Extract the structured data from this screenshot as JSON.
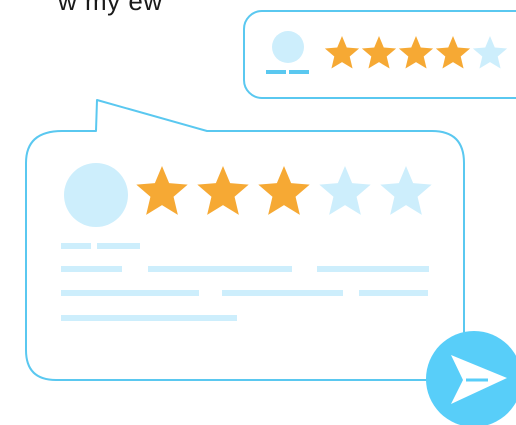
{
  "top_text": "w my ew",
  "colors": {
    "accent_blue": "#5ac8f0",
    "light_blue": "#cdeefc",
    "star_gold": "#f6a934",
    "star_empty": "#cdeefc",
    "send_button": "#58cef9",
    "white": "#ffffff"
  },
  "small_review_card": {
    "rating": 4,
    "max_rating": 5,
    "icon": "avatar-icon"
  },
  "main_review_card": {
    "rating": 3,
    "max_rating": 5,
    "icon": "avatar-icon"
  },
  "send_button": {
    "icon": "send-arrow-icon"
  }
}
